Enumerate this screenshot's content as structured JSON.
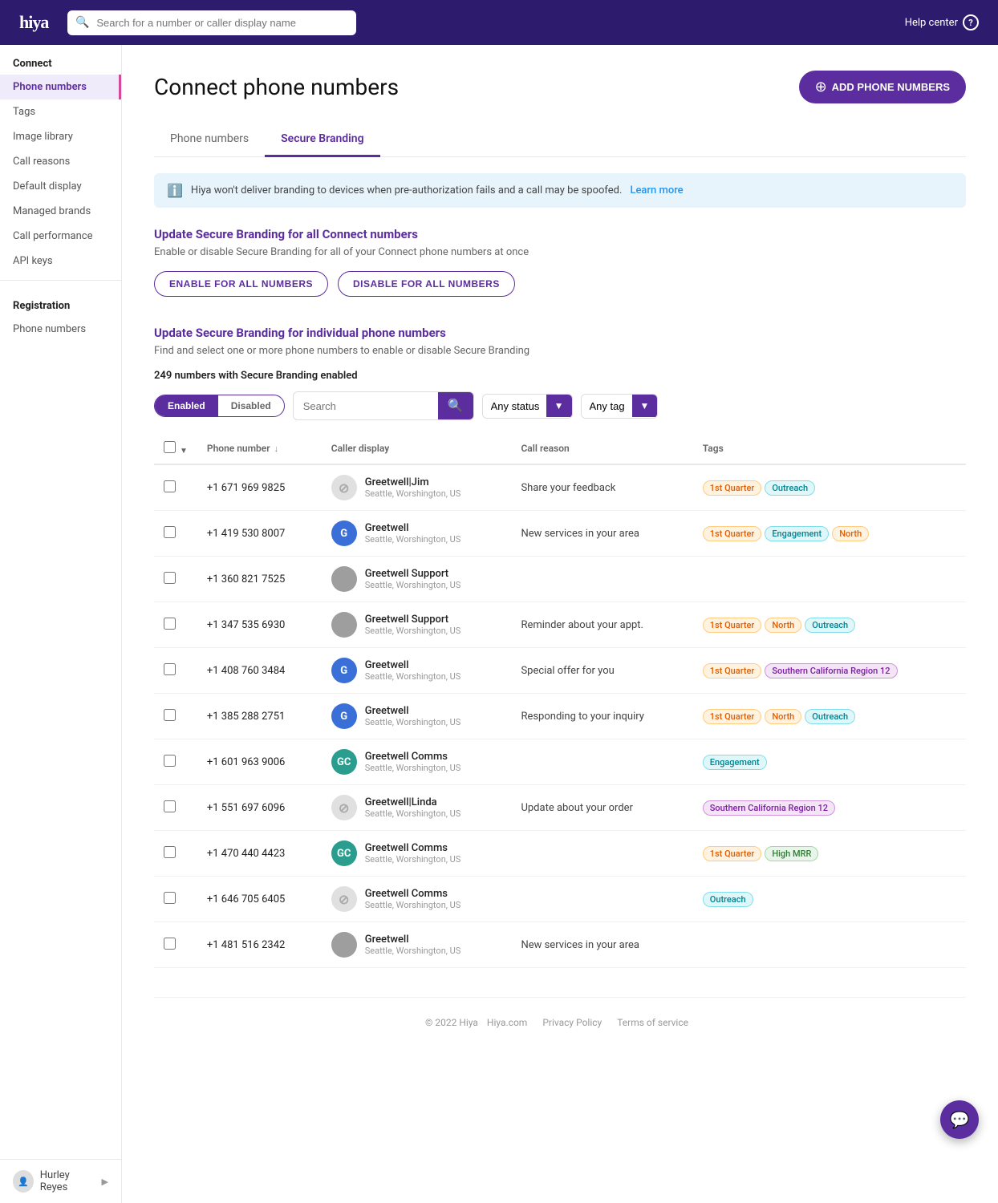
{
  "topBar": {
    "logo": "hiya",
    "searchPlaceholder": "Search for a number or caller display name",
    "helpCenter": "Help center"
  },
  "sidebar": {
    "connectLabel": "Connect",
    "connectItems": [
      {
        "label": "Phone numbers",
        "active": true
      },
      {
        "label": "Tags"
      },
      {
        "label": "Image library"
      },
      {
        "label": "Call reasons"
      },
      {
        "label": "Default display"
      },
      {
        "label": "Managed brands"
      },
      {
        "label": "Call performance"
      },
      {
        "label": "API keys"
      }
    ],
    "registrationLabel": "Registration",
    "registrationItems": [
      {
        "label": "Phone numbers"
      }
    ],
    "footer": {
      "user": "Hurley Reyes"
    }
  },
  "page": {
    "title": "Connect phone numbers",
    "addButton": "ADD PHONE NUMBERS",
    "tabs": [
      {
        "label": "Phone numbers"
      },
      {
        "label": "Secure Branding",
        "active": true
      }
    ],
    "infoBanner": {
      "text": "Hiya won't deliver branding to devices when pre-authorization fails and a call may be spoofed.",
      "linkText": "Learn more"
    },
    "allNumbersSection": {
      "title": "Update Secure Branding for all Connect numbers",
      "description": "Enable or disable Secure Branding for all of your Connect phone numbers at once",
      "enableBtn": "ENABLE FOR ALL NUMBERS",
      "disableBtn": "DISABLE FOR ALL NUMBERS"
    },
    "individualSection": {
      "title": "Update Secure Branding for individual phone numbers",
      "description": "Find and select one or more phone numbers to enable or disable Secure Branding",
      "countText": "249 numbers with Secure Branding enabled",
      "filter": {
        "enabledLabel": "Enabled",
        "disabledLabel": "Disabled",
        "searchPlaceholder": "Search",
        "anyStatus": "Any status",
        "anyTag": "Any tag"
      },
      "table": {
        "columns": [
          "Phone number",
          "Caller display",
          "Call reason",
          "Tags"
        ],
        "rows": [
          {
            "phone": "+1 671 969 9825",
            "callerName": "Greetwell|Jim",
            "callerLocation": "Seattle, Worshington, US",
            "avatarType": "placeholder",
            "avatarText": "",
            "callReason": "Share your feedback",
            "tags": [
              {
                "label": "1st Quarter",
                "type": "orange"
              },
              {
                "label": "Outreach",
                "type": "teal"
              }
            ]
          },
          {
            "phone": "+1 419 530 8007",
            "callerName": "Greetwell",
            "callerLocation": "Seattle, Worshington, US",
            "avatarType": "blue",
            "avatarText": "G",
            "callReason": "New services in your area",
            "tags": [
              {
                "label": "1st Quarter",
                "type": "orange"
              },
              {
                "label": "Engagement",
                "type": "teal"
              },
              {
                "label": "North",
                "type": "orange"
              }
            ]
          },
          {
            "phone": "+1 360 821 7525",
            "callerName": "Greetwell Support",
            "callerLocation": "Seattle, Worshington, US",
            "avatarType": "gray",
            "avatarText": "",
            "callReason": "",
            "tags": []
          },
          {
            "phone": "+1 347 535 6930",
            "callerName": "Greetwell Support",
            "callerLocation": "Seattle, Worshington, US",
            "avatarType": "gray",
            "avatarText": "",
            "callReason": "Reminder about your appt.",
            "tags": [
              {
                "label": "1st Quarter",
                "type": "orange"
              },
              {
                "label": "North",
                "type": "orange"
              },
              {
                "label": "Outreach",
                "type": "teal"
              }
            ]
          },
          {
            "phone": "+1 408 760 3484",
            "callerName": "Greetwell",
            "callerLocation": "Seattle, Worshington, US",
            "avatarType": "blue",
            "avatarText": "G",
            "callReason": "Special offer for you",
            "tags": [
              {
                "label": "1st Quarter",
                "type": "orange"
              },
              {
                "label": "Southern California Region 12",
                "type": "purple"
              }
            ]
          },
          {
            "phone": "+1 385 288 2751",
            "callerName": "Greetwell",
            "callerLocation": "Seattle, Worshington, US",
            "avatarType": "blue",
            "avatarText": "G",
            "callReason": "Responding to your inquiry",
            "tags": [
              {
                "label": "1st Quarter",
                "type": "orange"
              },
              {
                "label": "North",
                "type": "orange"
              },
              {
                "label": "Outreach",
                "type": "teal"
              }
            ]
          },
          {
            "phone": "+1 601 963 9006",
            "callerName": "Greetwell Comms",
            "callerLocation": "Seattle, Worshington, US",
            "avatarType": "teal",
            "avatarText": "GC",
            "callReason": "",
            "tags": [
              {
                "label": "Engagement",
                "type": "teal"
              }
            ]
          },
          {
            "phone": "+1 551 697 6096",
            "callerName": "Greetwell|Linda",
            "callerLocation": "Seattle, Worshington, US",
            "avatarType": "placeholder",
            "avatarText": "",
            "callReason": "Update about your order",
            "tags": [
              {
                "label": "Southern California Region 12",
                "type": "purple"
              }
            ]
          },
          {
            "phone": "+1 470 440 4423",
            "callerName": "Greetwell Comms",
            "callerLocation": "Seattle, Worshington, US",
            "avatarType": "teal",
            "avatarText": "GC",
            "callReason": "",
            "tags": [
              {
                "label": "1st Quarter",
                "type": "orange"
              },
              {
                "label": "High MRR",
                "type": "green"
              }
            ]
          },
          {
            "phone": "+1 646 705 6405",
            "callerName": "Greetwell Comms",
            "callerLocation": "Seattle, Worshington, US",
            "avatarType": "placeholder",
            "avatarText": "",
            "callReason": "",
            "tags": [
              {
                "label": "Outreach",
                "type": "teal"
              }
            ]
          },
          {
            "phone": "+1 481 516 2342",
            "callerName": "Greetwell",
            "callerLocation": "Seattle, Worshington, US",
            "avatarType": "gray",
            "avatarText": "",
            "callReason": "New services in your area",
            "tags": []
          }
        ]
      }
    }
  },
  "footer": {
    "copyright": "© 2022 Hiya",
    "links": [
      "Hiya.com",
      "Privacy Policy",
      "Terms of service"
    ]
  }
}
